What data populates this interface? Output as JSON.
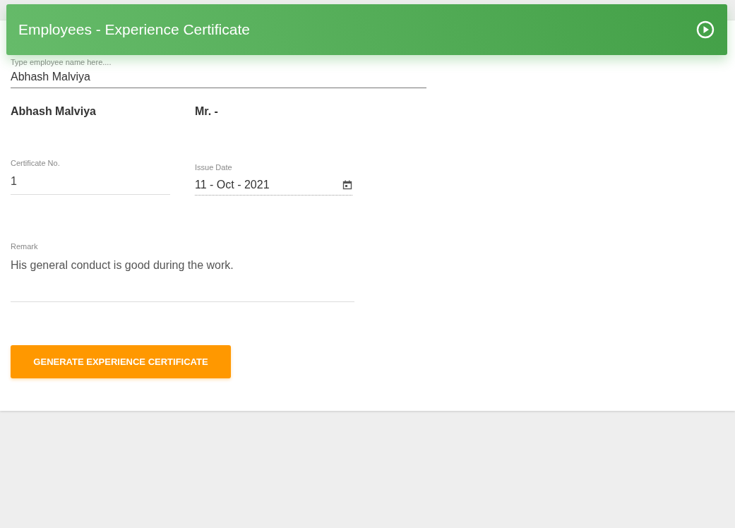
{
  "header": {
    "title": "Employees - Experience Certificate"
  },
  "employee_search": {
    "placeholder": "Type employee name here....",
    "value": "Abhash Malviya"
  },
  "employee_name": "Abhash Malviya",
  "salutation": "Mr. -",
  "certificate_no": {
    "label": "Certificate No.",
    "value": "1"
  },
  "issue_date": {
    "label": "Issue Date",
    "value": "11 - Oct - 2021"
  },
  "remark": {
    "label": "Remark",
    "value": "His general conduct is good during the work."
  },
  "button": "GENERATE EXPERIENCE CERTIFICATE"
}
